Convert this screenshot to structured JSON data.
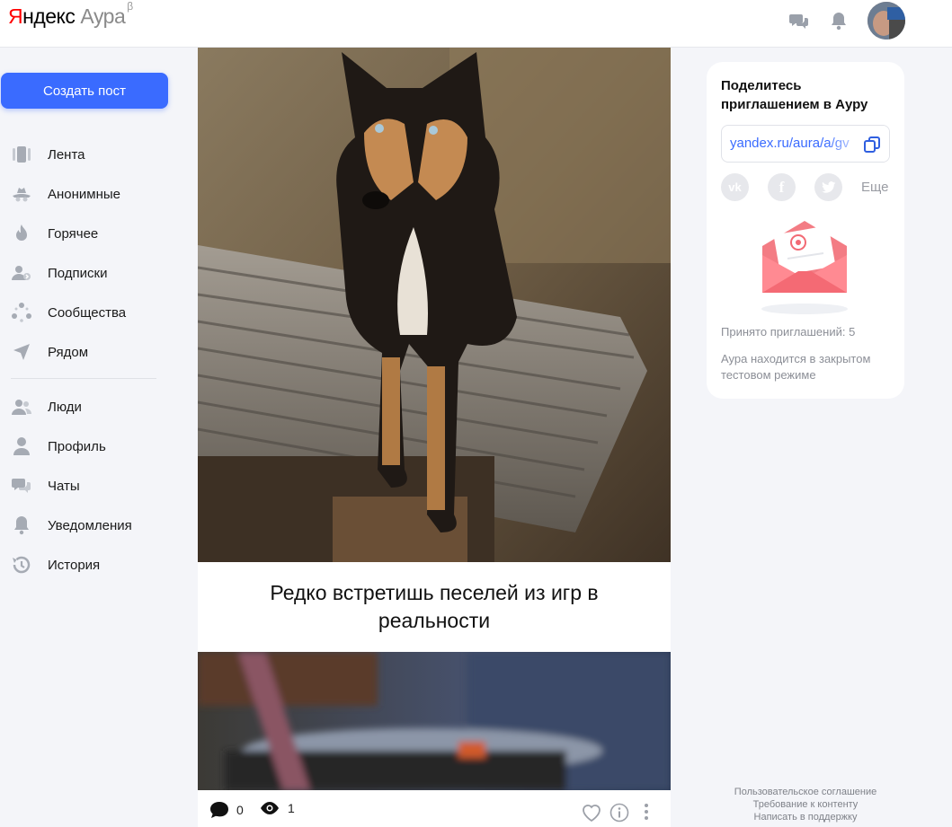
{
  "header": {
    "logo_ya": "Я",
    "logo_rest": "ндекс",
    "logo_aura": "Аура",
    "logo_beta": "β"
  },
  "sidebar": {
    "create_label": "Создать пост",
    "items": [
      {
        "label": "Лента",
        "icon": "feed-icon"
      },
      {
        "label": "Анонимные",
        "icon": "anonymous-icon"
      },
      {
        "label": "Горячее",
        "icon": "fire-icon"
      },
      {
        "label": "Подписки",
        "icon": "subscriptions-icon"
      },
      {
        "label": "Сообщества",
        "icon": "communities-icon"
      },
      {
        "label": "Рядом",
        "icon": "location-arrow-icon"
      },
      {
        "label": "Люди",
        "icon": "people-icon"
      },
      {
        "label": "Профиль",
        "icon": "profile-icon"
      },
      {
        "label": "Чаты",
        "icon": "chats-icon"
      },
      {
        "label": "Уведомления",
        "icon": "bell-icon"
      },
      {
        "label": "История",
        "icon": "history-icon"
      }
    ]
  },
  "post": {
    "caption": "Редко встретишь песелей из игр в реальности"
  },
  "post2": {
    "comments": "0",
    "views": "1"
  },
  "invite": {
    "title": "Поделитесь приглашением в Ауру",
    "link": "yandex.ru/aura/a/gv",
    "more": "Еще",
    "social": [
      {
        "name": "vk",
        "glyph": "vk"
      },
      {
        "name": "facebook",
        "glyph": "f"
      },
      {
        "name": "twitter",
        "glyph": "t"
      }
    ],
    "accepted": "Принято приглашений: 5",
    "closed_note": "Аура находится в закрытом тестовом режиме"
  },
  "footer": {
    "links": [
      "Пользовательское соглашение",
      "Требование к контенту",
      "Написать в поддержку"
    ]
  },
  "colors": {
    "accent": "#3a6bff",
    "icon_gray": "#8f949e",
    "envelope": "#f4707a"
  }
}
